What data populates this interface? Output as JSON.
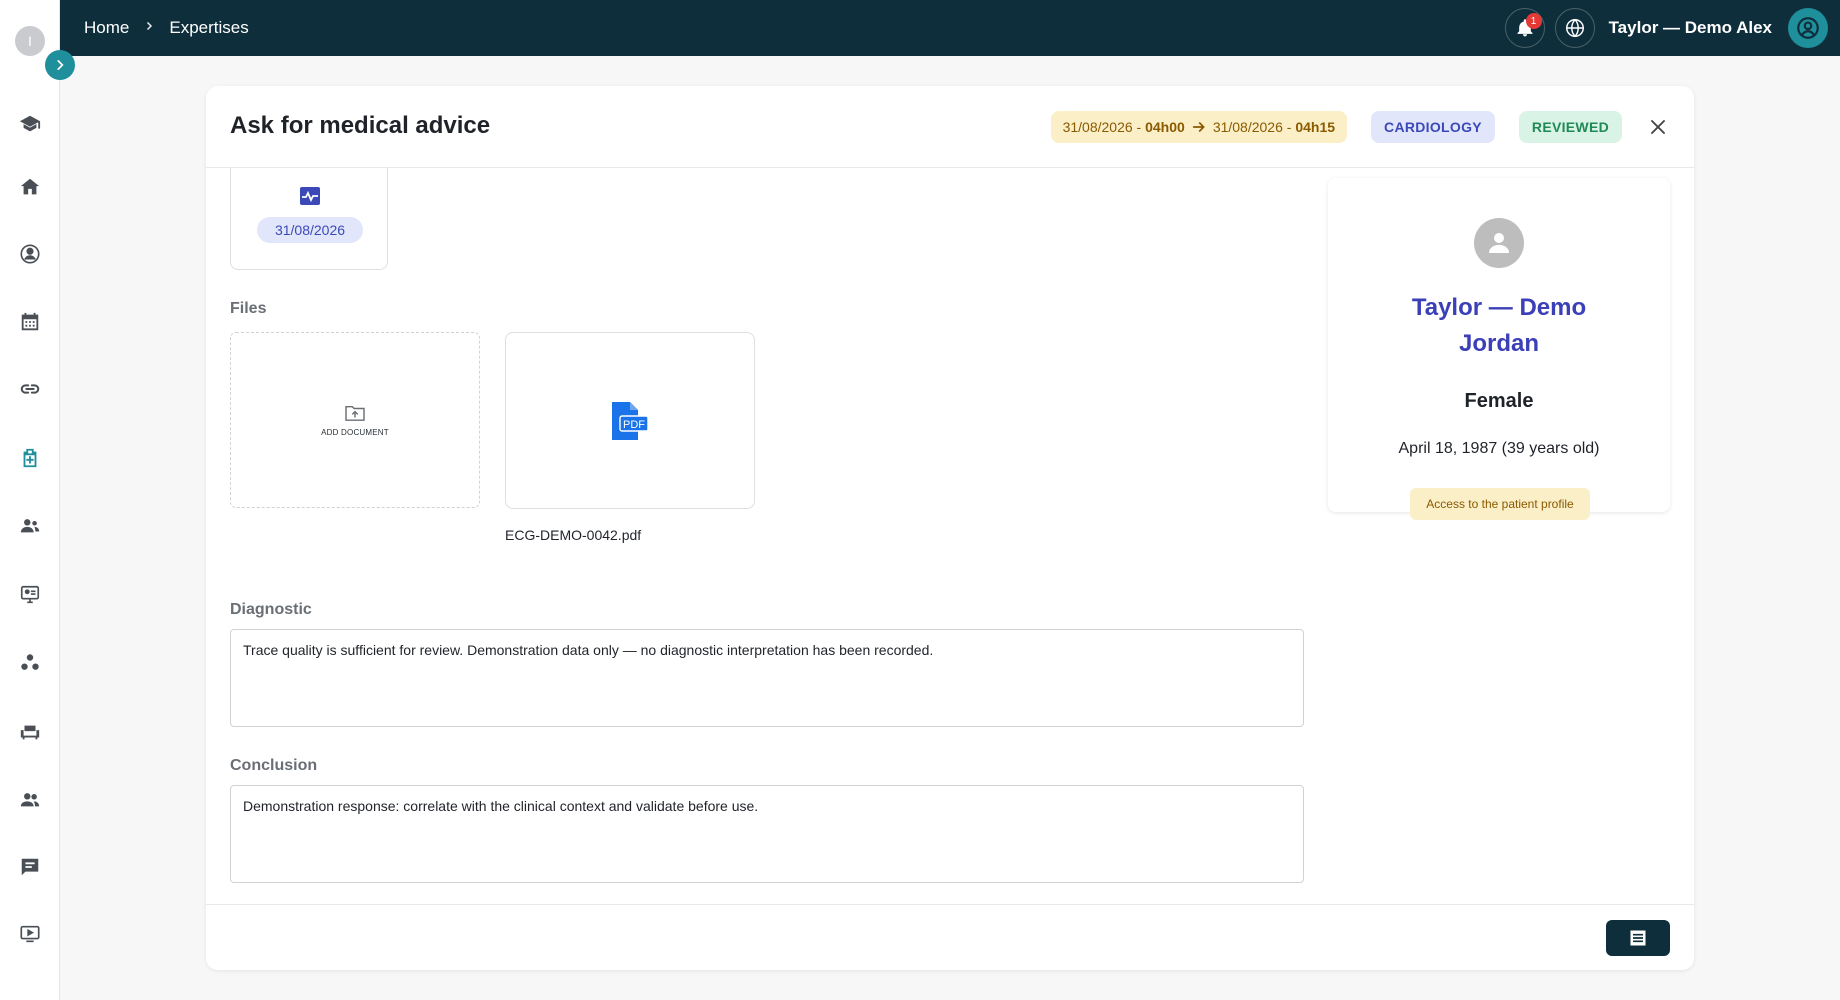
{
  "sidebar": {
    "avatar_initial": "I",
    "items": [
      {
        "icon": "graduation-cap-icon"
      },
      {
        "icon": "home-icon"
      },
      {
        "icon": "doctor-icon"
      },
      {
        "icon": "calendar-icon"
      },
      {
        "icon": "link-icon"
      },
      {
        "icon": "expertise-icon",
        "active": true
      },
      {
        "icon": "user-group-icon"
      },
      {
        "icon": "teleconsult-icon"
      },
      {
        "icon": "network-icon"
      },
      {
        "icon": "waiting-room-icon"
      },
      {
        "icon": "people-icon"
      },
      {
        "icon": "chat-icon"
      },
      {
        "icon": "video-icon"
      }
    ]
  },
  "topbar": {
    "breadcrumb": [
      "Home",
      "Expertises"
    ],
    "notifications_count": "1",
    "user_name": "Taylor — Demo Alex"
  },
  "panel": {
    "title": "Ask for medical advice",
    "start_date": "31/08/2026 - ",
    "start_time": "04h00",
    "end_date": "31/08/2026 - ",
    "end_time": "04h15",
    "specialty": "CARDIOLOGY",
    "status": "REVIEWED"
  },
  "exam": {
    "date": "31/08/2026"
  },
  "files": {
    "label": "Files",
    "add_label": "ADD DOCUMENT",
    "items": [
      {
        "name": "ECG-DEMO-0042.pdf",
        "type": "PDF"
      }
    ]
  },
  "diagnostic": {
    "label": "Diagnostic",
    "text": "Trace quality is sufficient for review. Demonstration data only — no diagnostic interpretation has been recorded."
  },
  "conclusion": {
    "label": "Conclusion",
    "text": "Demonstration response: correlate with the clinical context and validate before use."
  },
  "patient": {
    "name": "Taylor — Demo Jordan",
    "gender": "Female",
    "dob": "April 18, 1987 (39 years old)",
    "profile_link": "Access to the patient profile"
  },
  "colors": {
    "topbar": "#0d2e3a",
    "accent": "#1f8f9c",
    "patient_name": "#3b3fb8"
  }
}
